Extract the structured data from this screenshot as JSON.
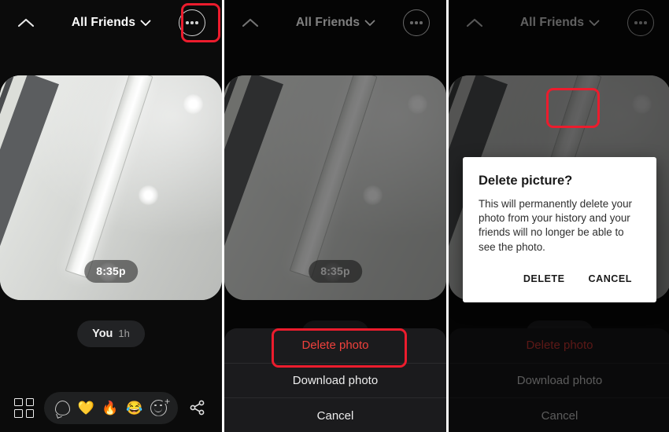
{
  "app": {
    "header": {
      "collapse_icon": "chevron-up-icon",
      "title": "All Friends",
      "dropdown_icon": "chevron-down-icon",
      "more_icon": "ellipsis-icon"
    },
    "photo": {
      "timestamp": "8:35p",
      "description": "ceiling-with-led-light-strip"
    },
    "attribution": {
      "author": "You",
      "age": "1h"
    },
    "bottom_bar": {
      "grid_icon": "grid-view-icon",
      "reactions": [
        {
          "name": "comment-bubble-icon",
          "glyph": ""
        },
        {
          "name": "yellow-heart-emoji",
          "glyph": "💛"
        },
        {
          "name": "fire-emoji",
          "glyph": "🔥"
        },
        {
          "name": "laughing-emoji",
          "glyph": "😂"
        },
        {
          "name": "add-reaction-icon",
          "glyph": ""
        }
      ],
      "share_icon": "share-icon"
    }
  },
  "action_sheet": {
    "items": [
      {
        "label": "Delete photo",
        "style": "danger"
      },
      {
        "label": "Download photo",
        "style": "normal"
      },
      {
        "label": "Cancel",
        "style": "normal"
      }
    ]
  },
  "alert": {
    "title": "Delete picture?",
    "body": "This will permanently delete your photo from your history and your friends will no longer be able to see the photo.",
    "confirm_label": "DELETE",
    "cancel_label": "CANCEL"
  },
  "colors": {
    "annotation_red": "#ec1c2d",
    "danger_text": "#f0413c",
    "panel_background": "#0b0b0b",
    "sheet_background": "#1b1b1d",
    "alert_background": "#ffffff"
  }
}
